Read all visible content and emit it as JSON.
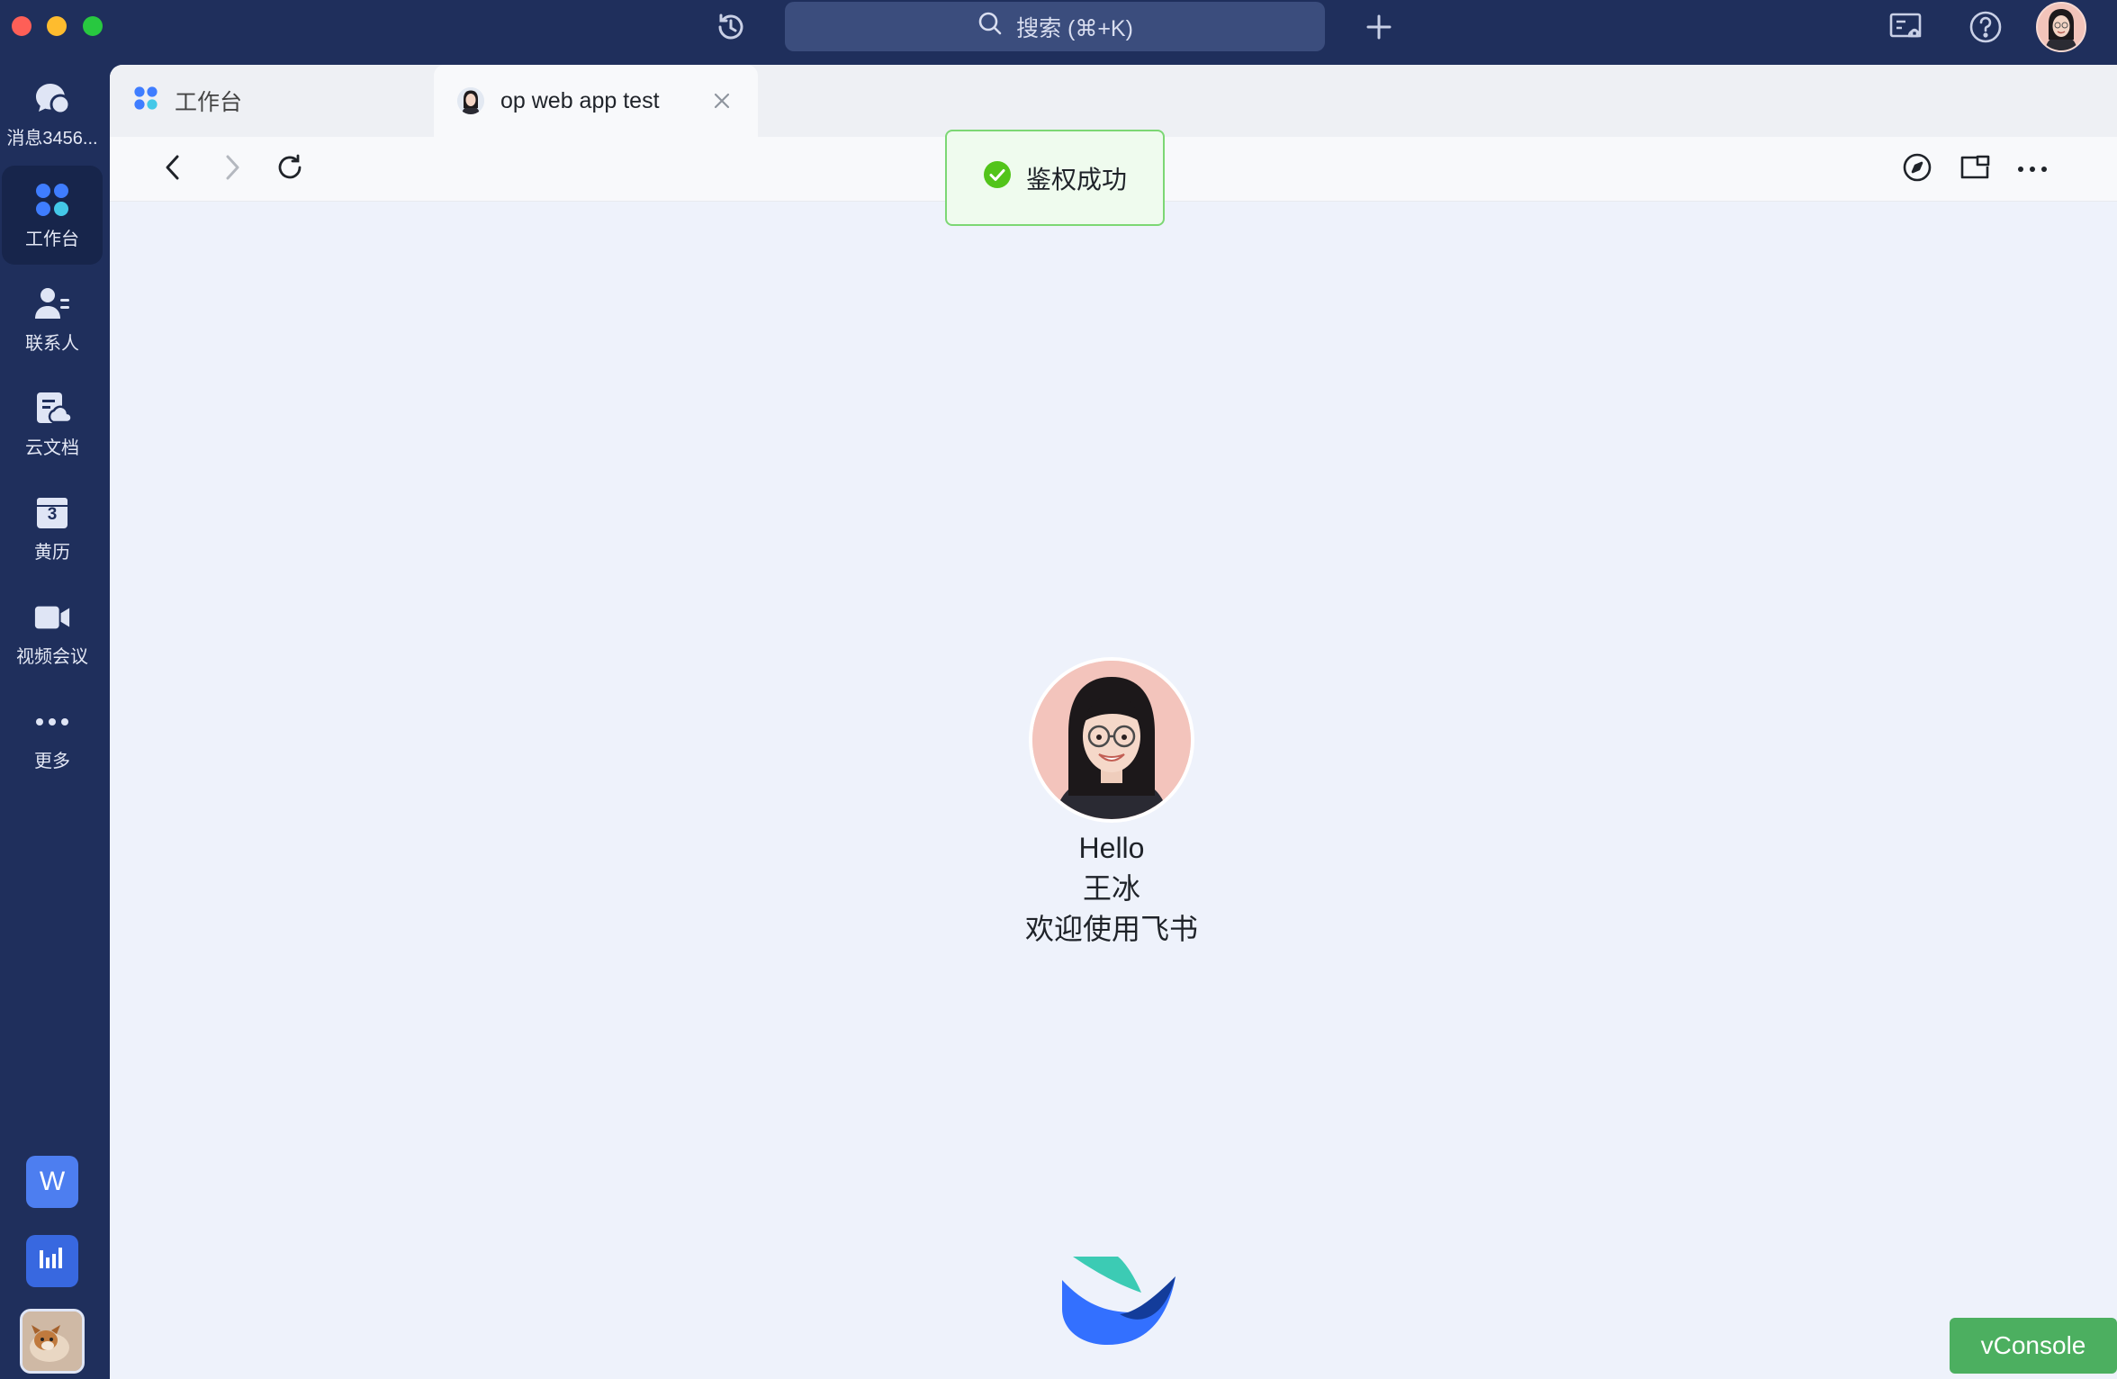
{
  "titlebar": {
    "search_placeholder": "搜索 (⌘+K)",
    "history_icon": "history-icon",
    "add_icon": "plus-icon",
    "notice_icon": "notice-icon",
    "help_icon": "help-icon"
  },
  "rail": {
    "items": [
      {
        "label": "消息3456...",
        "icon": "messages-icon"
      },
      {
        "label": "工作台",
        "icon": "workplace-icon"
      },
      {
        "label": "联系人",
        "icon": "contacts-icon"
      },
      {
        "label": "云文档",
        "icon": "docs-icon"
      },
      {
        "label": "黄历",
        "icon": "calendar-icon",
        "badge": "3"
      },
      {
        "label": "视频会议",
        "icon": "video-icon"
      },
      {
        "label": "更多",
        "icon": "more-icon"
      }
    ],
    "apps": [
      {
        "label": "W",
        "color": "#4d7ef0"
      },
      {
        "label": "",
        "icon": "chart-app-icon",
        "color": "#3868e0"
      }
    ]
  },
  "tabs": [
    {
      "label": "工作台",
      "icon": "workplace-icon"
    },
    {
      "label": "op web app test",
      "icon": "avatar-icon"
    }
  ],
  "toast": {
    "text": "鉴权成功",
    "color": "#52c41a"
  },
  "profile": {
    "greeting": "Hello",
    "name": "王冰",
    "welcome": "欢迎使用飞书"
  },
  "vconsole": {
    "label": "vConsole",
    "color": "#4caf60"
  }
}
